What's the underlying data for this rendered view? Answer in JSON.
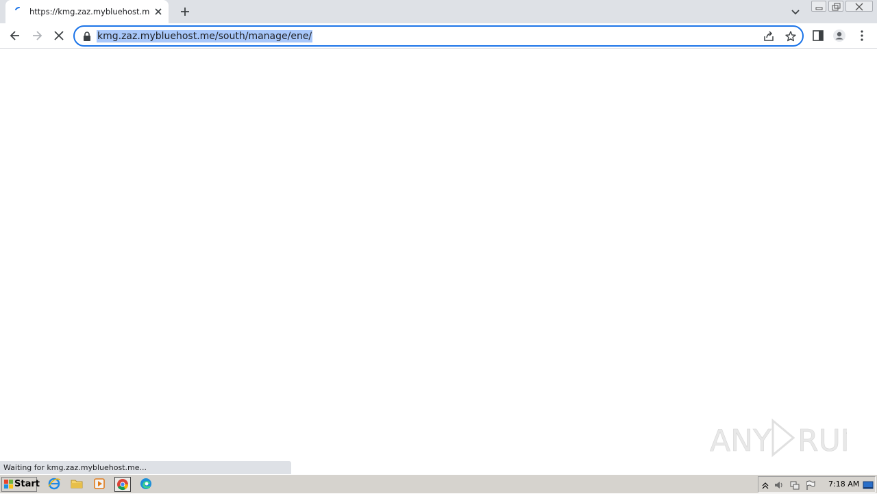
{
  "tab": {
    "title": "https://kmg.zaz.mybluehost.me/south/manage/ene/",
    "loading": true
  },
  "omnibox": {
    "url": "kmg.zaz.mybluehost.me/south/manage/ene/",
    "url_selected": true
  },
  "status_bar": {
    "text": "Waiting for kmg.zaz.mybluehost.me..."
  },
  "watermark": {
    "text": "ANY RUN"
  },
  "taskbar": {
    "start_label": "Start",
    "clock": "7:18 AM",
    "apps": [
      "internet-explorer",
      "file-explorer",
      "media-player",
      "chrome",
      "edge"
    ]
  },
  "colors": {
    "accent": "#1a73e8",
    "selection": "#a8c7fa",
    "tabstrip": "#dee1e6"
  }
}
